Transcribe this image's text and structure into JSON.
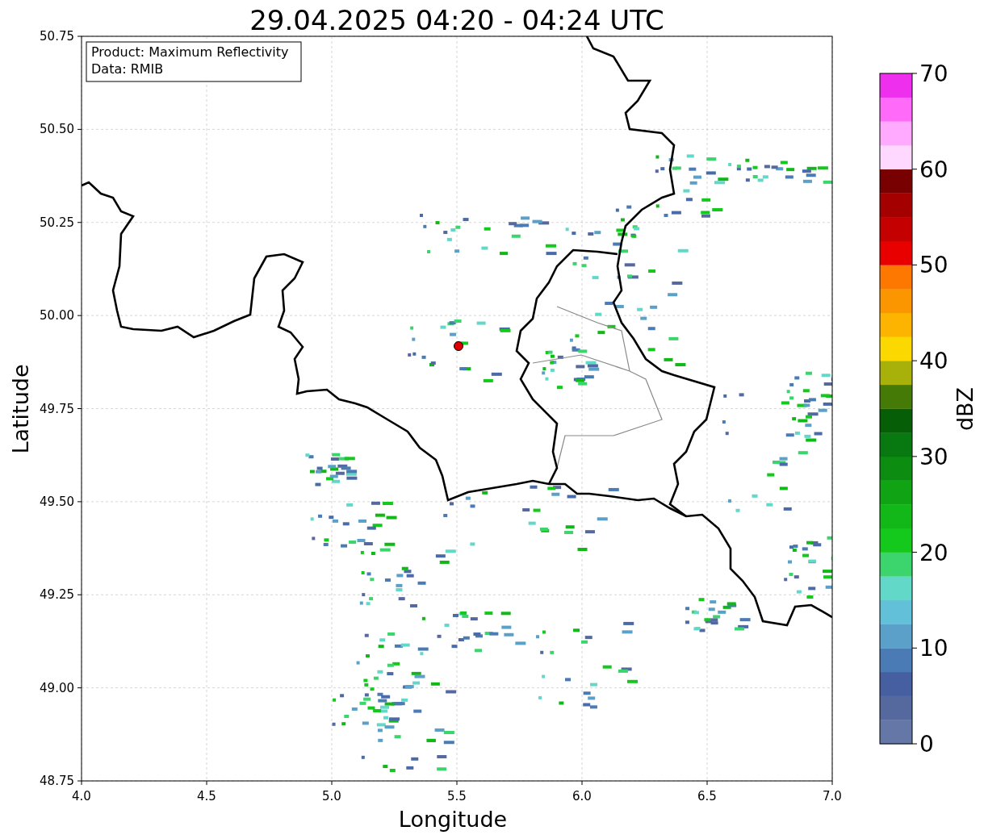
{
  "title": "29.04.2025 04:20 - 04:24 UTC",
  "map": {
    "legend_lines": [
      "Product: Maximum Reflectivity",
      "Data: RMIB"
    ],
    "xlabel": "Longitude",
    "ylabel": "Latitude",
    "xticks": [
      "4.0",
      "4.5",
      "5.0",
      "5.5",
      "6.0",
      "6.5",
      "7.0"
    ],
    "yticks": [
      "50.75",
      "50.50",
      "50.25",
      "50.00",
      "49.75",
      "49.50",
      "49.25",
      "49.00",
      "48.75"
    ]
  },
  "colorbar": {
    "label": "dBZ",
    "ticks": [
      "70",
      "60",
      "50",
      "40",
      "30",
      "20",
      "10",
      "0"
    ],
    "segments": [
      {
        "color": "#6477a6"
      },
      {
        "color": "#56699f"
      },
      {
        "color": "#465fa0"
      },
      {
        "color": "#4a7bb4"
      },
      {
        "color": "#5aa0c8"
      },
      {
        "color": "#62c0d8"
      },
      {
        "color": "#62d8c8"
      },
      {
        "color": "#3cd46c"
      },
      {
        "color": "#14c81c"
      },
      {
        "color": "#12b818"
      },
      {
        "color": "#10a414"
      },
      {
        "color": "#0c8c10"
      },
      {
        "color": "#087810"
      },
      {
        "color": "#065e06"
      },
      {
        "color": "#467a06"
      },
      {
        "color": "#a8b00a"
      },
      {
        "color": "#fad800"
      },
      {
        "color": "#fcb400"
      },
      {
        "color": "#fc9600"
      },
      {
        "color": "#fc7800"
      },
      {
        "color": "#e80000"
      },
      {
        "color": "#c40000"
      },
      {
        "color": "#a40000"
      },
      {
        "color": "#780000"
      },
      {
        "color": "#ffd8ff"
      },
      {
        "color": "#ffaaff"
      },
      {
        "color": "#ff6af8"
      },
      {
        "color": "#ee30ee"
      }
    ]
  }
}
